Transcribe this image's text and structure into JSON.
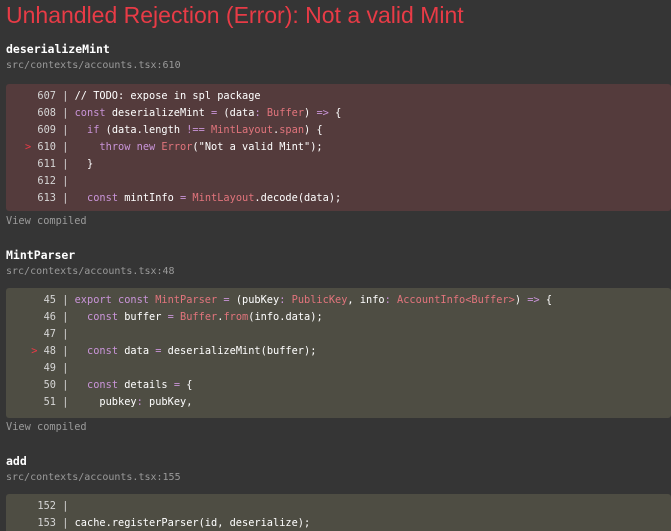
{
  "error": {
    "title": "Unhandled Rejection (Error): Not a valid Mint"
  },
  "frames": [
    {
      "name": "deserializeMint",
      "location": "src/contexts/accounts.tsx:610",
      "view_label": "View compiled",
      "lines": [
        {
          "marker": "",
          "num": "607",
          "tokens": [
            {
              "t": "plain",
              "v": "// TODO: expose in spl package"
            }
          ]
        },
        {
          "marker": "",
          "num": "608",
          "tokens": [
            {
              "t": "kw",
              "v": "const "
            },
            {
              "t": "plain",
              "v": "deserializeMint "
            },
            {
              "t": "op",
              "v": "= "
            },
            {
              "t": "plain",
              "v": "("
            },
            {
              "t": "plain",
              "v": "data"
            },
            {
              "t": "op",
              "v": ": "
            },
            {
              "t": "type",
              "v": "Buffer"
            },
            {
              "t": "plain",
              "v": ") "
            },
            {
              "t": "op",
              "v": "=> "
            },
            {
              "t": "plain",
              "v": "{"
            }
          ]
        },
        {
          "marker": "",
          "num": "609",
          "tokens": [
            {
              "t": "plain",
              "v": "  "
            },
            {
              "t": "kw",
              "v": "if "
            },
            {
              "t": "plain",
              "v": "(data.length "
            },
            {
              "t": "op",
              "v": "!== "
            },
            {
              "t": "type",
              "v": "MintLayout"
            },
            {
              "t": "plain",
              "v": "."
            },
            {
              "t": "type",
              "v": "span"
            },
            {
              "t": "plain",
              "v": ") {"
            }
          ]
        },
        {
          "marker": ">",
          "num": "610",
          "tokens": [
            {
              "t": "plain",
              "v": "    "
            },
            {
              "t": "kw",
              "v": "throw new "
            },
            {
              "t": "type",
              "v": "Error"
            },
            {
              "t": "plain",
              "v": "(\"Not a valid Mint\");"
            }
          ]
        },
        {
          "marker": "",
          "num": "611",
          "tokens": [
            {
              "t": "plain",
              "v": "  }"
            }
          ]
        },
        {
          "marker": "",
          "num": "612",
          "tokens": []
        },
        {
          "marker": "",
          "num": "613",
          "tokens": [
            {
              "t": "plain",
              "v": "  "
            },
            {
              "t": "kw",
              "v": "const "
            },
            {
              "t": "plain",
              "v": "mintInfo "
            },
            {
              "t": "op",
              "v": "= "
            },
            {
              "t": "type",
              "v": "MintLayout"
            },
            {
              "t": "plain",
              "v": "."
            },
            {
              "t": "plain",
              "v": "decode(data);"
            }
          ]
        }
      ]
    },
    {
      "name": "MintParser",
      "location": "src/contexts/accounts.tsx:48",
      "view_label": "View compiled",
      "lines": [
        {
          "marker": "",
          "num": "45",
          "tokens": [
            {
              "t": "kw",
              "v": "export const "
            },
            {
              "t": "type",
              "v": "MintParser "
            },
            {
              "t": "op",
              "v": "= "
            },
            {
              "t": "plain",
              "v": "(pubKey"
            },
            {
              "t": "op",
              "v": ": "
            },
            {
              "t": "type",
              "v": "PublicKey"
            },
            {
              "t": "plain",
              "v": ", info"
            },
            {
              "t": "op",
              "v": ": "
            },
            {
              "t": "type",
              "v": "AccountInfo<Buffer>"
            },
            {
              "t": "plain",
              "v": ") "
            },
            {
              "t": "op",
              "v": "=> "
            },
            {
              "t": "plain",
              "v": "{"
            }
          ]
        },
        {
          "marker": "",
          "num": "46",
          "tokens": [
            {
              "t": "plain",
              "v": "  "
            },
            {
              "t": "kw",
              "v": "const "
            },
            {
              "t": "plain",
              "v": "buffer "
            },
            {
              "t": "op",
              "v": "= "
            },
            {
              "t": "type",
              "v": "Buffer"
            },
            {
              "t": "plain",
              "v": "."
            },
            {
              "t": "type",
              "v": "from"
            },
            {
              "t": "plain",
              "v": "(info.data);"
            }
          ]
        },
        {
          "marker": "",
          "num": "47",
          "tokens": []
        },
        {
          "marker": ">",
          "num": "48",
          "tokens": [
            {
              "t": "plain",
              "v": "  "
            },
            {
              "t": "kw",
              "v": "const "
            },
            {
              "t": "plain",
              "v": "data "
            },
            {
              "t": "op",
              "v": "= "
            },
            {
              "t": "plain",
              "v": "deserializeMint(buffer);"
            }
          ]
        },
        {
          "marker": "",
          "num": "49",
          "tokens": []
        },
        {
          "marker": "",
          "num": "50",
          "tokens": [
            {
              "t": "plain",
              "v": "  "
            },
            {
              "t": "kw",
              "v": "const "
            },
            {
              "t": "plain",
              "v": "details "
            },
            {
              "t": "op",
              "v": "= "
            },
            {
              "t": "plain",
              "v": "{"
            }
          ]
        },
        {
          "marker": "",
          "num": "51",
          "tokens": [
            {
              "t": "plain",
              "v": "    pubkey"
            },
            {
              "t": "op",
              "v": ": "
            },
            {
              "t": "plain",
              "v": "pubKey,"
            }
          ]
        }
      ]
    },
    {
      "name": "add",
      "location": "src/contexts/accounts.tsx:155",
      "lines": [
        {
          "marker": "",
          "num": "152",
          "tokens": []
        },
        {
          "marker": "",
          "num": "153",
          "tokens": [
            {
              "t": "plain",
              "v": "cache"
            },
            {
              "t": "plain",
              "v": "."
            },
            {
              "t": "plain",
              "v": "registerParser(id, deserialize);"
            }
          ]
        }
      ]
    }
  ]
}
